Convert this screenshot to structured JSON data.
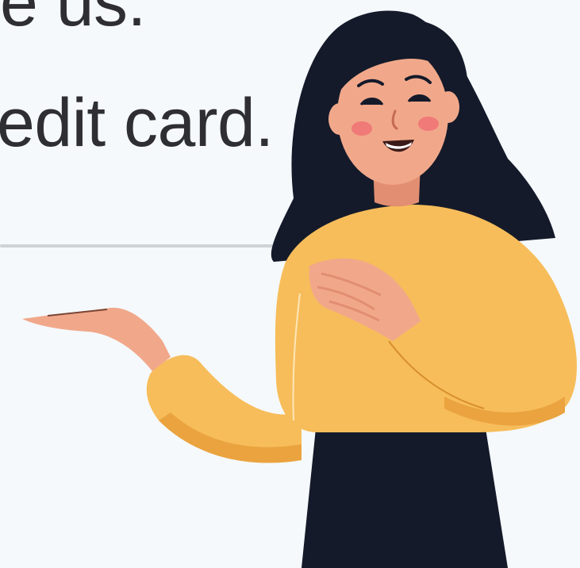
{
  "headline": {
    "line1": "e us.",
    "line2": "edit card."
  },
  "illustration": {
    "name": "woman-presenting-illustration",
    "colors": {
      "hair": "#141a2a",
      "skin": "#f1a88a",
      "skin_shade": "#e28e72",
      "sweater": "#f7bd5a",
      "sweater_shade": "#eaa33f",
      "skirt": "#141a2a",
      "cheek": "#f07a78",
      "background": "#f5f9fc",
      "text": "#2e2e33",
      "divider": "#cfd3d6"
    }
  }
}
